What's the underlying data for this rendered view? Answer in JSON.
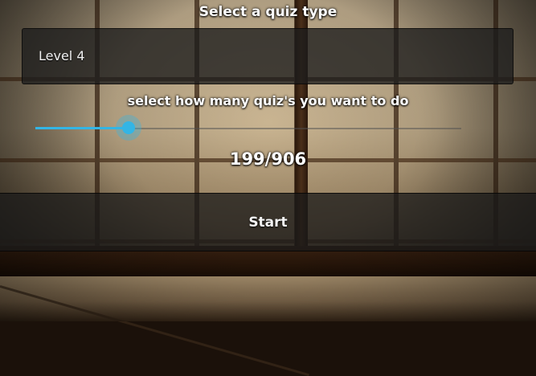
{
  "screen": {
    "title": "Select a quiz type",
    "quiz_type": {
      "selected": "Level 4"
    },
    "slider_label": "select how many quiz's you want to do",
    "quiz_count": {
      "current": 199,
      "max": 906,
      "display": "199/906"
    },
    "start_label": "Start"
  },
  "colors": {
    "accent": "#33b5e5",
    "panel": "#1c1c1c"
  }
}
